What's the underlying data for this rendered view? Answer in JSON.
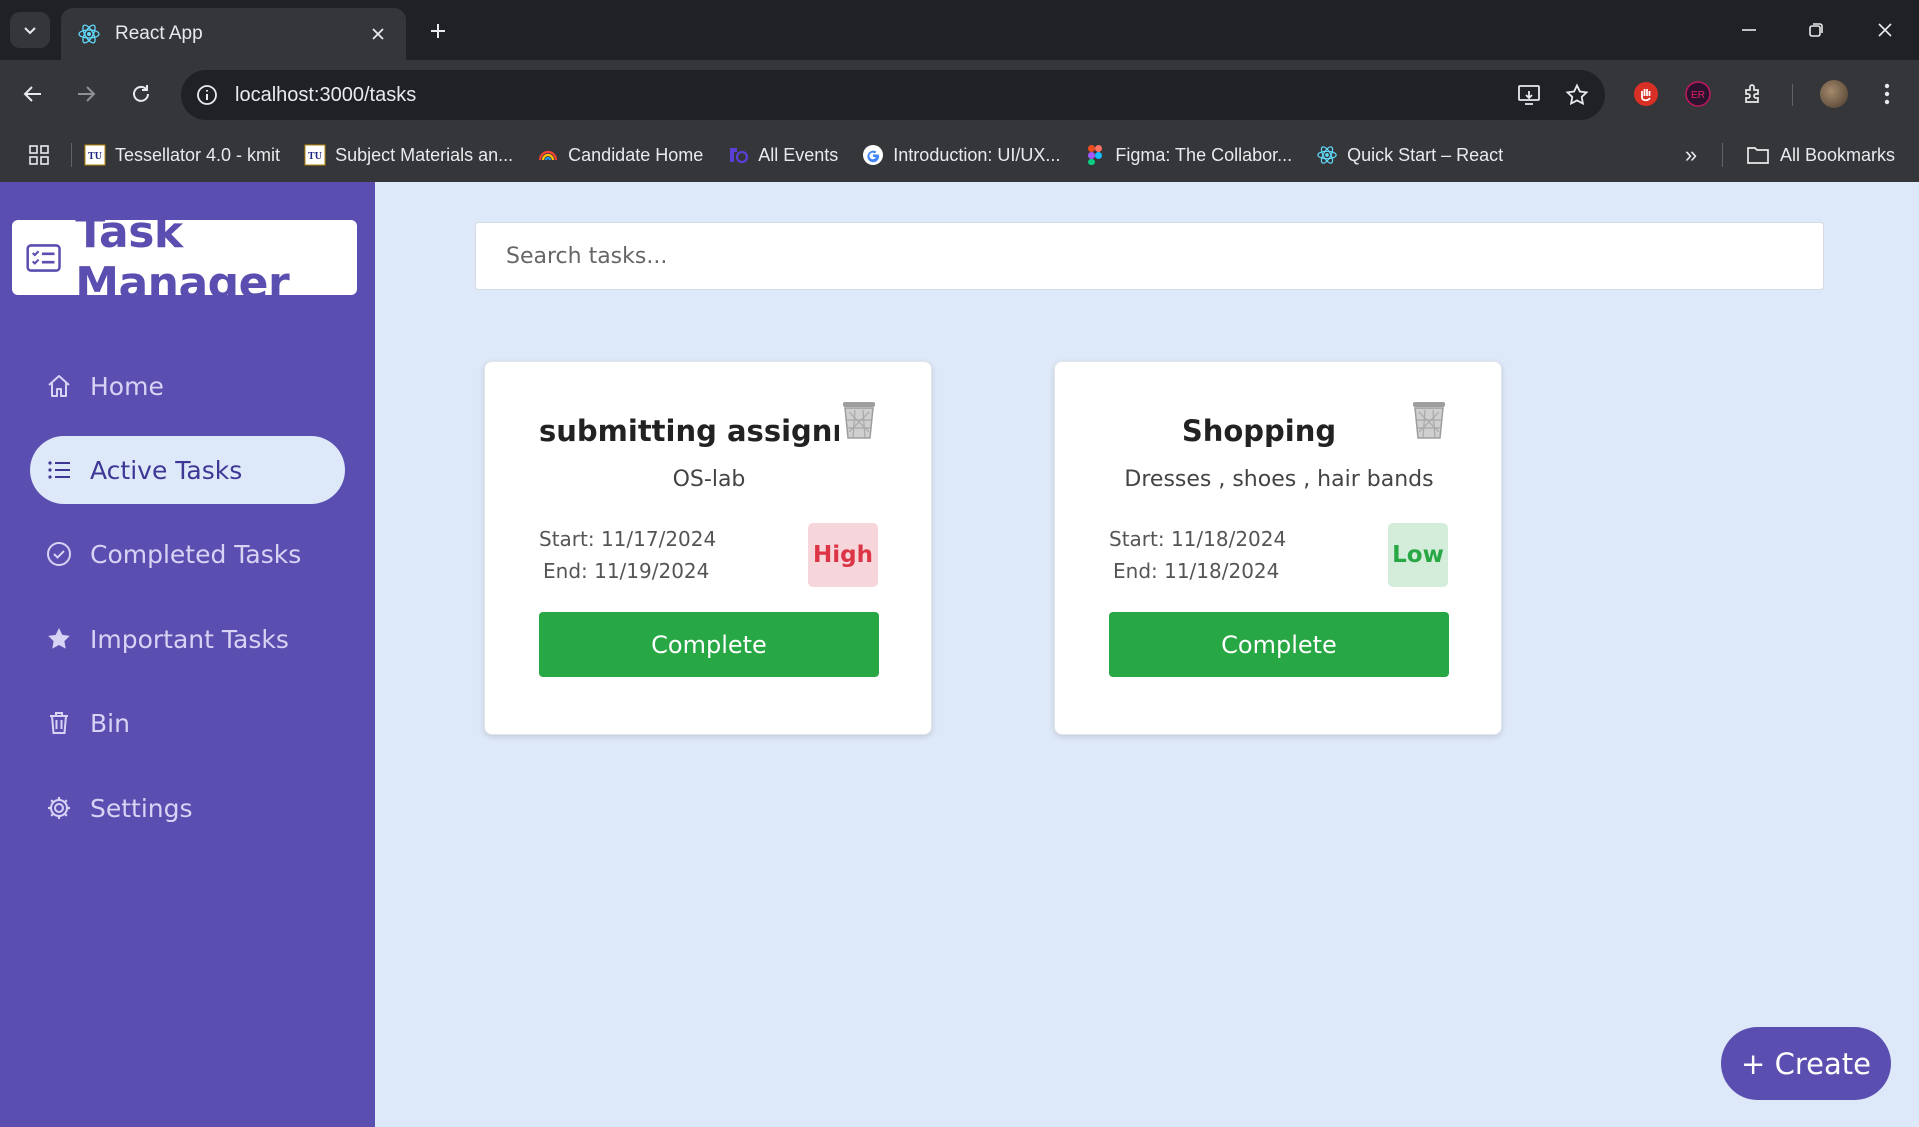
{
  "browser": {
    "tab_title": "React App",
    "url": "localhost:3000/tasks",
    "bookmarks": [
      {
        "label": "Tessellator 4.0 - kmit",
        "icon": "tu-logo-icon"
      },
      {
        "label": "Subject Materials an...",
        "icon": "tu-logo-icon"
      },
      {
        "label": "Candidate Home",
        "icon": "rainbow-icon"
      },
      {
        "label": "All Events",
        "icon": "unstop-icon"
      },
      {
        "label": "Introduction: UI/UX...",
        "icon": "google-icon"
      },
      {
        "label": "Figma: The Collabor...",
        "icon": "figma-icon"
      },
      {
        "label": "Quick Start – React",
        "icon": "react-icon"
      }
    ],
    "all_bookmarks_label": "All Bookmarks"
  },
  "sidebar": {
    "logo_text": "Task Manager",
    "items": [
      {
        "label": "Home",
        "icon": "home-icon"
      },
      {
        "label": "Active Tasks",
        "icon": "list-icon",
        "active": true
      },
      {
        "label": "Completed Tasks",
        "icon": "check-circle-icon"
      },
      {
        "label": "Important Tasks",
        "icon": "star-icon"
      },
      {
        "label": "Bin",
        "icon": "trash-icon"
      },
      {
        "label": "Settings",
        "icon": "gear-icon"
      }
    ]
  },
  "search": {
    "placeholder": "Search tasks..."
  },
  "tasks": [
    {
      "title": "submitting assignment",
      "description": "OS-lab",
      "start": "Start: 11/17/2024",
      "end": "End: 11/19/2024",
      "priority": "High",
      "complete_label": "Complete"
    },
    {
      "title": "Shopping",
      "description": "Dresses , shoes , hair bands",
      "start": "Start: 11/18/2024",
      "end": "End: 11/18/2024",
      "priority": "Low",
      "complete_label": "Complete"
    }
  ],
  "create_button": "+ Create",
  "colors": {
    "sidebar_bg": "#5a4fb0",
    "content_bg": "#dde8f8",
    "complete_green": "#28a745",
    "high_red": "#dc3545",
    "low_green": "#28a745"
  }
}
